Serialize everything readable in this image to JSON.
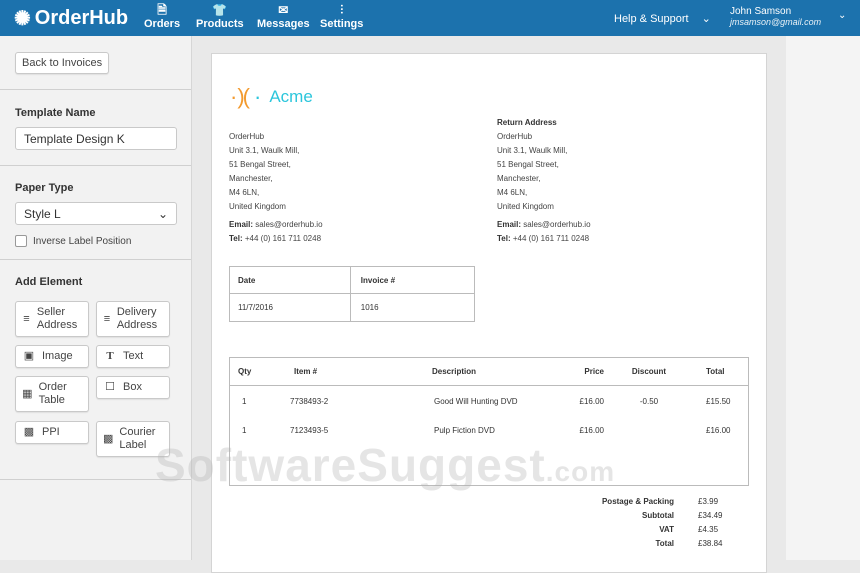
{
  "header": {
    "brand": "OrderHub",
    "nav": [
      {
        "label": "Orders",
        "icon": "document-icon"
      },
      {
        "label": "Products",
        "icon": "tshirt-icon"
      },
      {
        "label": "Messages",
        "icon": "envelope-icon"
      },
      {
        "label": "Settings",
        "icon": "sliders-icon"
      }
    ],
    "help": "Help & Support",
    "user_name": "John Samson",
    "user_email": "jmsamson@gmail.com",
    "color": "#1c72ad"
  },
  "sidebar": {
    "back": "Back to Invoices",
    "template_name_label": "Template Name",
    "template_name": "Template Design K",
    "paper_type_label": "Paper Type",
    "paper_type": "Style L",
    "inverse_label": "Inverse Label Position",
    "add_element_label": "Add Element",
    "elements": [
      {
        "label": "Seller Address"
      },
      {
        "label": "Delivery Address"
      },
      {
        "label": "Image"
      },
      {
        "label": "Text"
      },
      {
        "label": "Order Table"
      },
      {
        "label": "Box"
      },
      {
        "label": "PPI"
      },
      {
        "label": "Courier Label"
      }
    ]
  },
  "invoice": {
    "logo_text": "Acme",
    "seller": {
      "lines": [
        "OrderHub",
        "Unit 3.1, Waulk Mill,",
        "51 Bengal Street,",
        "Manchester,",
        "M4 6LN,",
        "United Kingdom"
      ],
      "email_label": "Email:",
      "email": "sales@orderhub.io",
      "tel_label": "Tel:",
      "tel": "+44 (0) 161 711 0248"
    },
    "return": {
      "title": "Return Address",
      "lines": [
        "OrderHub",
        "Unit 3.1, Waulk Mill,",
        "51 Bengal Street,",
        "Manchester,",
        "M4 6LN,",
        "United Kingdom"
      ],
      "email_label": "Email:",
      "email": "sales@orderhub.io",
      "tel_label": "Tel:",
      "tel": "+44 (0) 161 711 0248"
    },
    "meta": {
      "date_label": "Date",
      "date": "11/7/2016",
      "invoice_label": "Invoice #",
      "invoice": "1016"
    },
    "columns": [
      "Qty",
      "Item #",
      "Description",
      "Price",
      "Discount",
      "Total"
    ],
    "rows": [
      [
        "1",
        "7738493-2",
        "Good Will Hunting DVD",
        "£16.00",
        "-0.50",
        "£15.50"
      ],
      [
        "1",
        "7123493-5",
        "Pulp Fiction DVD",
        "£16.00",
        "",
        "£16.00"
      ]
    ],
    "totals": [
      {
        "label": "Postage & Packing",
        "value": "£3.99"
      },
      {
        "label": "Subtotal",
        "value": "£34.49"
      },
      {
        "label": "VAT",
        "value": "£4.35"
      },
      {
        "label": "Total",
        "value": "£38.84"
      }
    ]
  },
  "watermark": {
    "text": "SoftwareSuggest",
    ".com": ".com"
  }
}
